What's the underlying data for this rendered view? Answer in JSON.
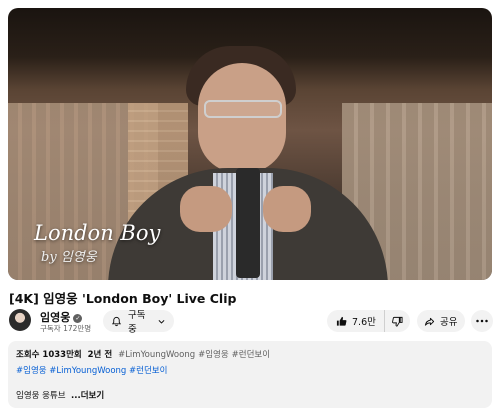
{
  "video": {
    "overlay_title": "London Boy",
    "overlay_by": "by 임영웅",
    "title": "[4K] 임영웅 'London Boy' Live Clip"
  },
  "channel": {
    "name": "임영웅",
    "subscribers": "구독자 172만명",
    "subscribe_label": "구독중"
  },
  "actions": {
    "likes": "7.6만",
    "share_label": "공유"
  },
  "description": {
    "views": "조회수 1033만회",
    "age": "2년 전",
    "tags_line1": [
      "#LimYoungWoong",
      "#임영웅",
      "#런던보이"
    ],
    "tags_line2": [
      "#임영웅",
      "#LimYoungWoong",
      "#런던보이"
    ],
    "preview": "임영웅 웅튜브",
    "more_label": "...더보기"
  },
  "colors": {
    "link": "#065fd4",
    "pill_bg": "#f2f2f2"
  }
}
